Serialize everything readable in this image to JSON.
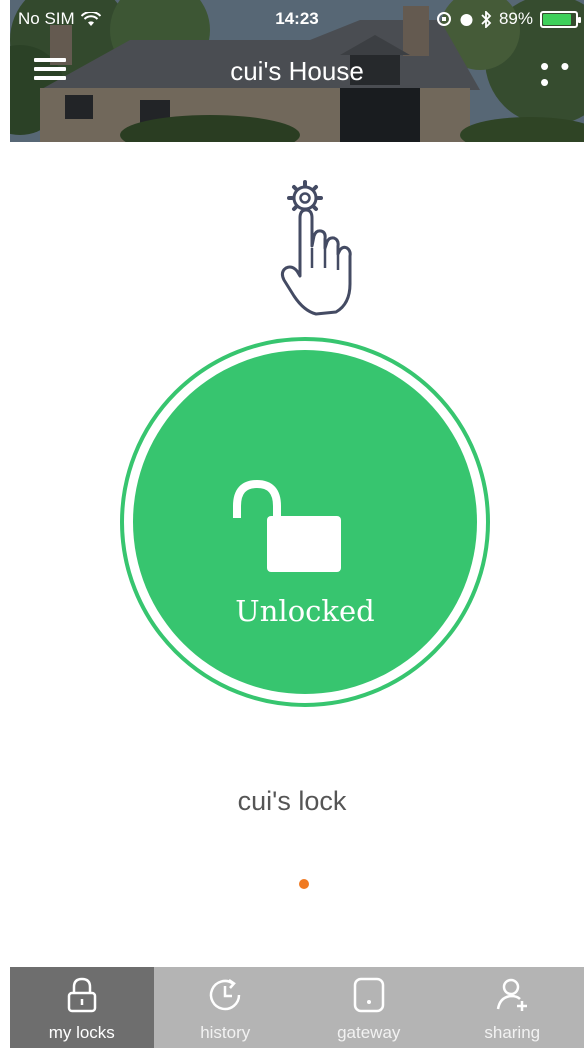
{
  "status_bar": {
    "carrier": "No SIM",
    "time": "14:23",
    "battery": "89%",
    "battery_level": 0.89
  },
  "header": {
    "title": "cui's House",
    "menu_icon": "hamburger-menu-icon",
    "more_icon": "more-dots-icon",
    "more_label": "• • •"
  },
  "gesture_hint": {
    "icons": [
      "gear-icon",
      "pointing-hand-icon"
    ]
  },
  "lock": {
    "status": "Unlocked",
    "icon": "unlocked-padlock-icon",
    "name": "cui's lock"
  },
  "pager": {
    "current": 1,
    "total": 1
  },
  "tabs": [
    {
      "label": "my locks",
      "icon": "lock-icon",
      "active": true
    },
    {
      "label": "history",
      "icon": "history-clock-icon",
      "active": false
    },
    {
      "label": "gateway",
      "icon": "gateway-icon",
      "active": false
    },
    {
      "label": "sharing",
      "icon": "add-user-icon",
      "active": false
    }
  ],
  "colors": {
    "accent_green": "#37c56f",
    "page_dot": "#f07a22",
    "tab_active": "#6e6e6e",
    "tab_inactive": "#b4b4b4"
  }
}
